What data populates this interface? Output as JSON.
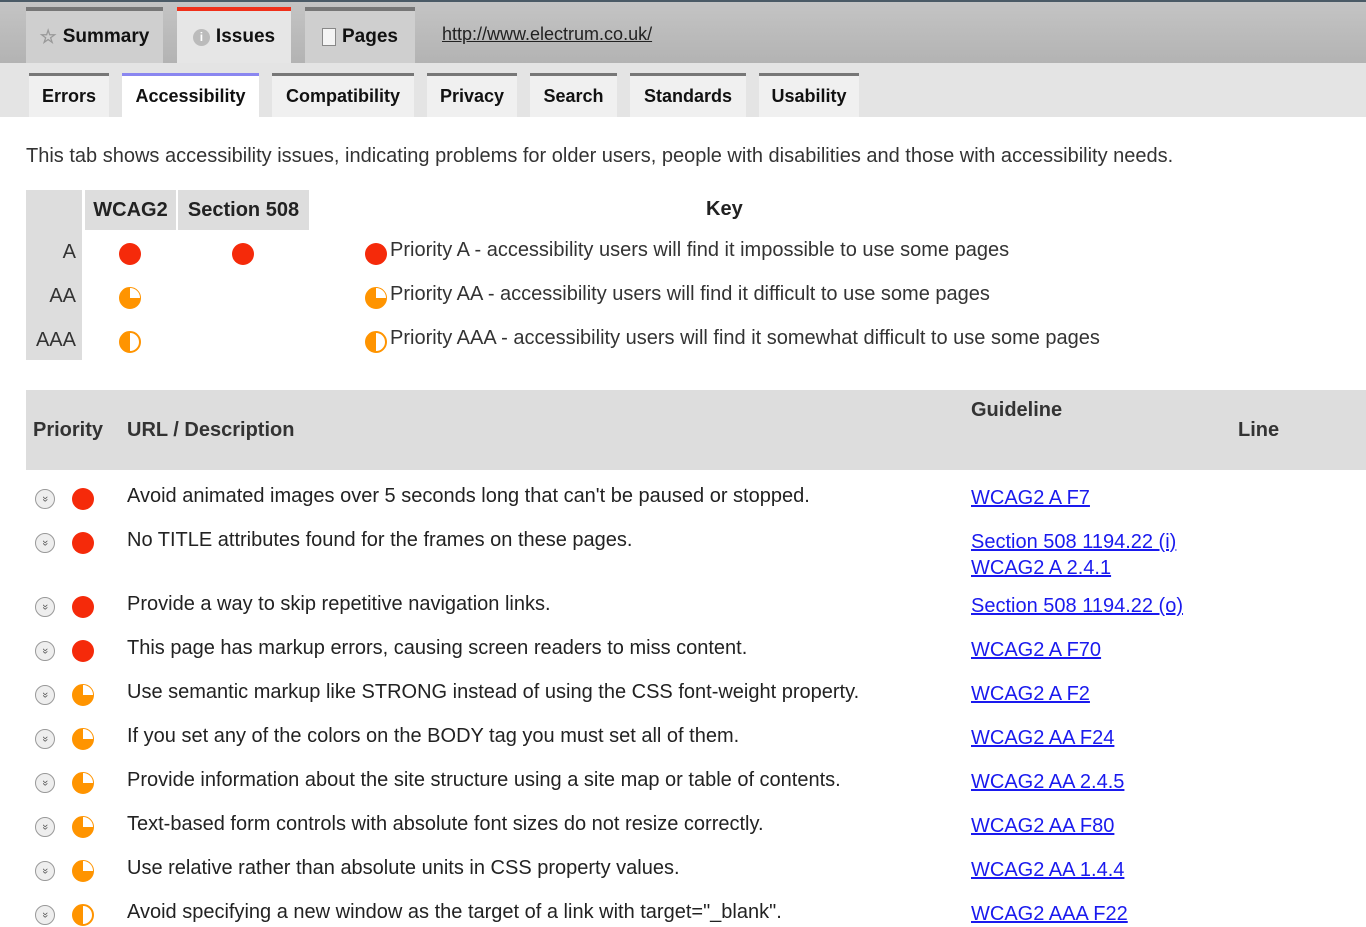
{
  "tabs": [
    {
      "label": "Summary",
      "icon": "star-icon"
    },
    {
      "label": "Issues",
      "icon": "info-icon",
      "active": true
    },
    {
      "label": "Pages",
      "icon": "page-icon"
    }
  ],
  "url": "http://www.electrum.co.uk/",
  "subtabs": [
    "Errors",
    "Accessibility",
    "Compatibility",
    "Privacy",
    "Search",
    "Standards",
    "Usability"
  ],
  "active_subtab": "Accessibility",
  "intro": "This tab shows accessibility issues, indicating problems for older users, people with disabilities and those with accessibility needs.",
  "summary": {
    "col_wcag": "WCAG2",
    "col_508": "Section 508",
    "levels": [
      "A",
      "AA",
      "AAA"
    ]
  },
  "key": {
    "title": "Key",
    "items": [
      "Priority A - accessibility users will find it impossible to use some pages",
      "Priority AA - accessibility users will find it difficult to use some pages",
      "Priority AAA - accessibility users will find it somewhat difficult to use some pages"
    ]
  },
  "table": {
    "headers": {
      "priority": "Priority",
      "description": "URL / Description",
      "guideline": "Guideline",
      "line": "Line"
    },
    "rows": [
      {
        "priority": "A",
        "description": "Avoid animated images over 5 seconds long that can't be paused or stopped.",
        "guidelines": [
          "WCAG2 A F7"
        ]
      },
      {
        "priority": "A",
        "description": "No TITLE attributes found for the frames on these pages.",
        "guidelines": [
          "Section 508 1194.22 (i)",
          "WCAG2 A 2.4.1"
        ]
      },
      {
        "priority": "A",
        "description": "Provide a way to skip repetitive navigation links.",
        "guidelines": [
          "Section 508 1194.22 (o)"
        ]
      },
      {
        "priority": "A",
        "description": "This page has markup errors, causing screen readers to miss content.",
        "guidelines": [
          "WCAG2 A F70"
        ]
      },
      {
        "priority": "AA",
        "description": "Use semantic markup like STRONG instead of using the CSS font-weight property.",
        "guidelines": [
          "WCAG2 A F2"
        ]
      },
      {
        "priority": "AA",
        "description": "If you set any of the colors on the BODY tag you must set all of them.",
        "guidelines": [
          "WCAG2 AA F24"
        ]
      },
      {
        "priority": "AA",
        "description": "Provide information about the site structure using a site map or table of contents.",
        "guidelines": [
          "WCAG2 AA 2.4.5"
        ]
      },
      {
        "priority": "AA",
        "description": "Text-based form controls with absolute font sizes do not resize correctly.",
        "guidelines": [
          "WCAG2 AA F80"
        ]
      },
      {
        "priority": "AA",
        "description": "Use relative rather than absolute units in CSS property values.",
        "guidelines": [
          "WCAG2 AA 1.4.4"
        ]
      },
      {
        "priority": "AAA",
        "description": "Avoid specifying a new window as the target of a link with target=\"_blank\".",
        "guidelines": [
          "WCAG2 AAA F22"
        ]
      }
    ]
  },
  "colors": {
    "red": "#f52a0a",
    "orange": "#ff9400",
    "link": "#1a1aee"
  }
}
